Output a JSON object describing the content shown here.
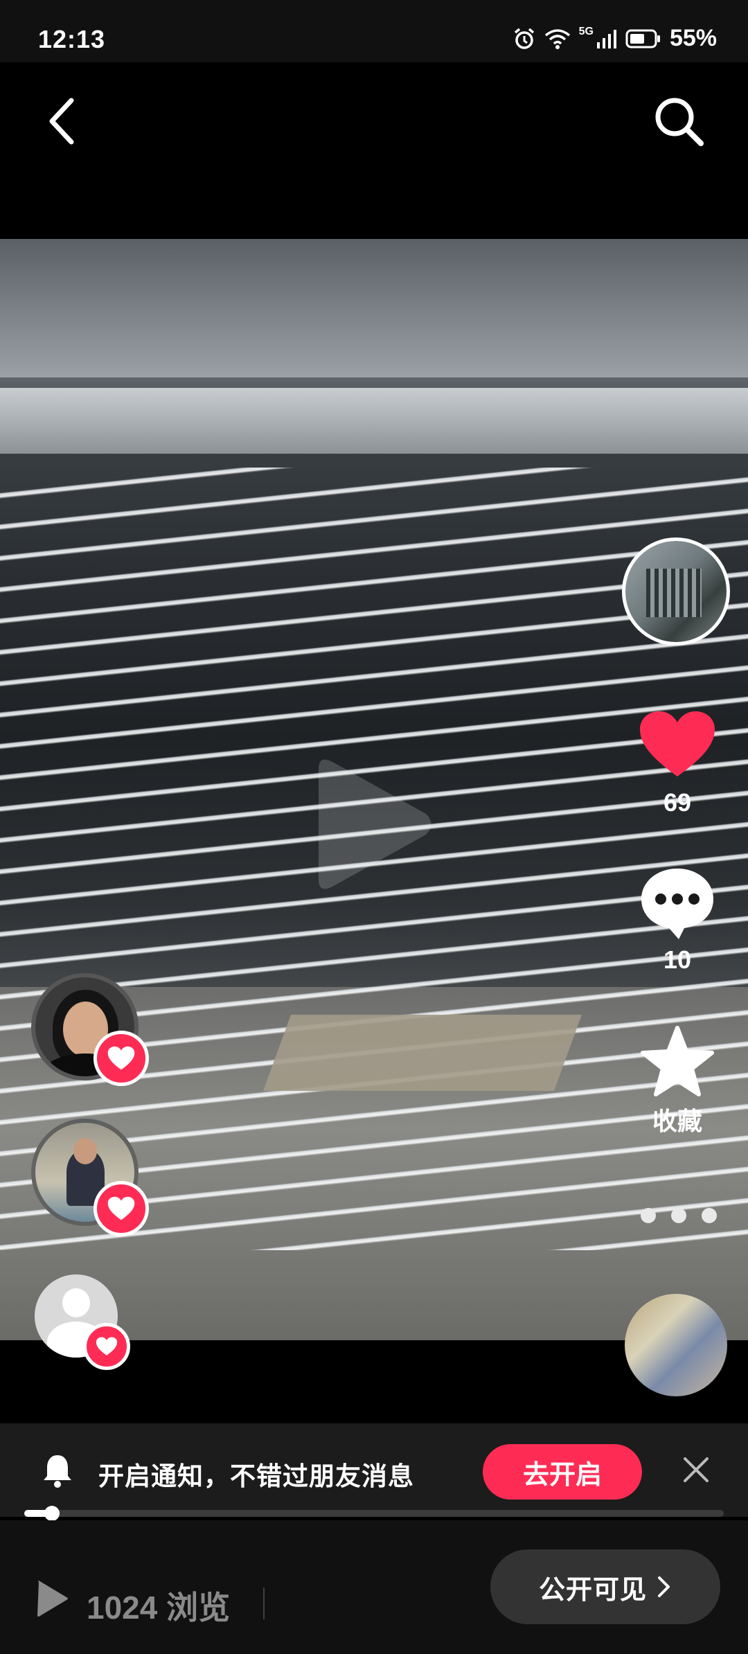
{
  "status_bar": {
    "time": "12:13",
    "network": "5G",
    "battery": "55%"
  },
  "video": {
    "play_icon": "play-icon"
  },
  "actions": {
    "like_count": "69",
    "comment_count": "10",
    "collect_label": "收藏"
  },
  "notify": {
    "text": "开启通知，不错过朋友消息",
    "button_label": "去开启"
  },
  "progress": {
    "value": 0.04
  },
  "bottom": {
    "views_label": "1024 浏览",
    "visibility_label": "公开可见"
  },
  "colors": {
    "accent": "#fe2c55",
    "background": "#000000"
  }
}
